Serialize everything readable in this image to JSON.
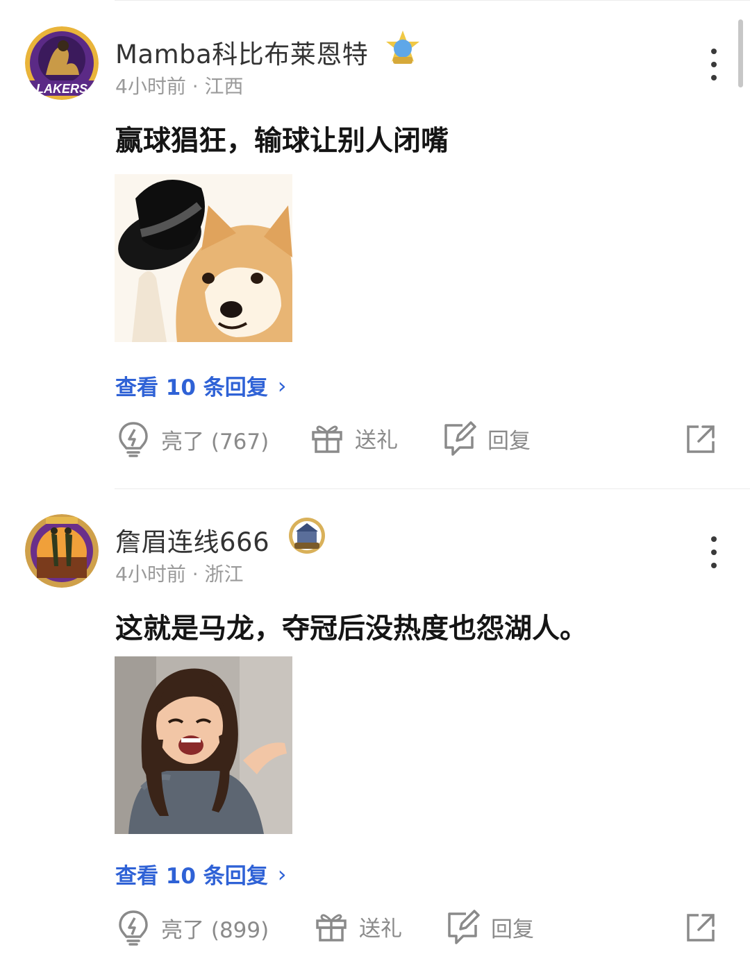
{
  "comments": [
    {
      "username": "Mamba科比布莱恩特",
      "meta": "4小时前 · 江西",
      "text": "赢球猖狂，输球让别人闭嘴",
      "avatar_label": "LAKERS",
      "replies_label": "查看 10 条回复",
      "actions": {
        "like": "亮了 (767)",
        "gift": "送礼",
        "reply": "回复"
      }
    },
    {
      "username": "詹眉连线666",
      "meta": "4小时前 · 浙江",
      "text": "这就是马龙，夺冠后没热度也怨湖人。",
      "replies_label": "查看 10 条回复",
      "actions": {
        "like": "亮了 (899)",
        "gift": "送礼",
        "reply": "回复"
      }
    }
  ],
  "colors": {
    "link": "#2f62d6",
    "icon": "#8a8a8a",
    "text": "#151515",
    "meta": "#9a9a9a"
  },
  "icons": [
    "more-vertical-icon",
    "lightbulb-icon",
    "gift-icon",
    "reply-edit-icon",
    "share-icon",
    "chevron-right-icon"
  ]
}
